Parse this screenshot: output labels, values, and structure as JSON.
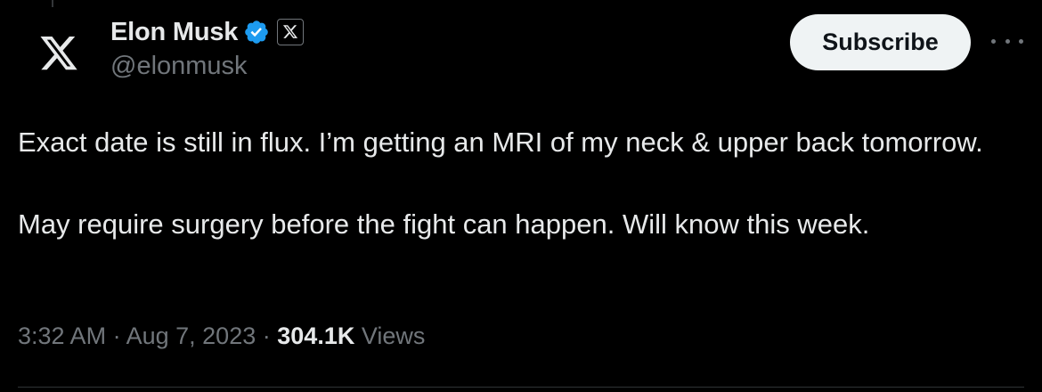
{
  "author": {
    "display_name": "Elon Musk",
    "handle": "@elonmusk",
    "avatar_icon": "x-logo-icon",
    "verified_icon": "verified-badge-icon",
    "affiliation_icon": "x-affiliation-badge-icon"
  },
  "actions": {
    "subscribe_label": "Subscribe",
    "more_icon": "more-options-icon"
  },
  "tweet": {
    "paragraphs": [
      "Exact date is still in flux. I’m getting an MRI of my neck & upper back tomorrow.",
      "May require surgery before the fight can happen. Will know this week."
    ]
  },
  "meta": {
    "time": "3:32 AM",
    "separator": "·",
    "date": "Aug 7, 2023",
    "views_count": "304.1K",
    "views_label": "Views"
  },
  "colors": {
    "background": "#000000",
    "text_primary": "#e7e9ea",
    "text_secondary": "#71767b",
    "verified_blue": "#1d9bf0",
    "button_bg": "#eff3f4",
    "button_text": "#0f1419",
    "divider": "#2f3336"
  }
}
